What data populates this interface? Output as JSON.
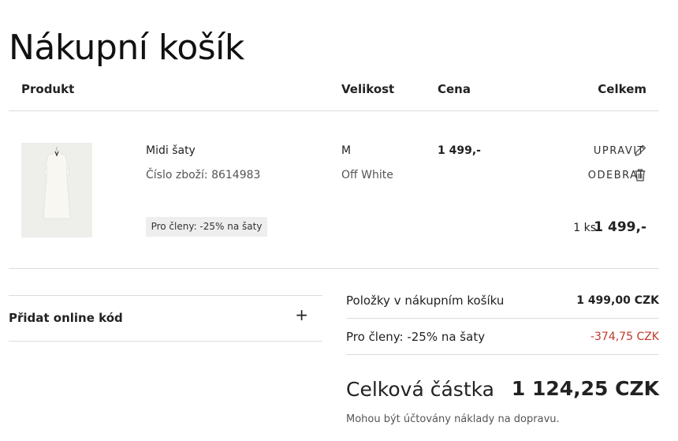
{
  "page_title": "Nákupní košík",
  "columns": {
    "product": "Produkt",
    "size": "Velikost",
    "price": "Cena",
    "total": "Celkem"
  },
  "item": {
    "name": "Midi šaty",
    "article": "Číslo zboží: 8614983",
    "size": "M",
    "color": "Off White",
    "price": "1 499,-",
    "edit_label": "UPRAVIT",
    "remove_label": "ODEBRAT",
    "promo_badge": "Pro členy: -25% na šaty",
    "quantity": "1 ks",
    "line_total": "1 499,-",
    "image_color": "#f6f5f0"
  },
  "promo_code": {
    "label": "Přidat online kód",
    "toggle": "+"
  },
  "summary": {
    "items_label": "Položky v nákupním košíku",
    "items_value": "1 499,00 CZK",
    "discount_label": "Pro členy: -25% na šaty",
    "discount_value": "-374,75 CZK",
    "total_label": "Celková částka",
    "total_value": "1 124,25 CZK",
    "shipping_note": "Mohou být účtovány náklady na dopravu.",
    "discount_color": "#c0392b"
  }
}
